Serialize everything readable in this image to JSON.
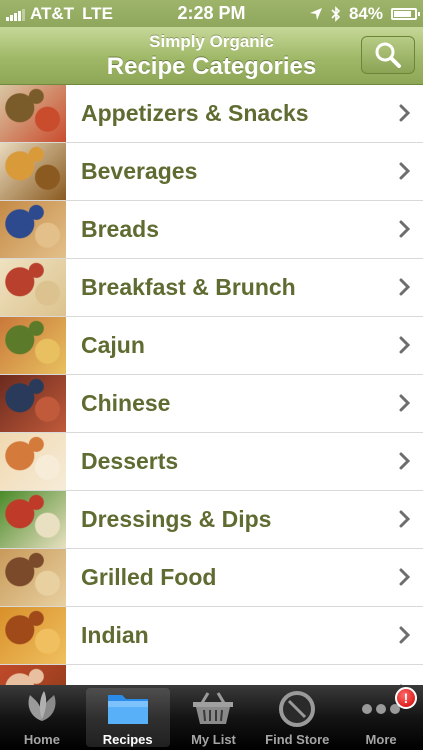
{
  "status_bar": {
    "carrier": "AT&T",
    "network": "LTE",
    "time": "2:28 PM",
    "battery": "84%",
    "battery_level": 0.84
  },
  "nav": {
    "subtitle": "Simply Organic",
    "title": "Recipe Categories",
    "search_icon": "magnifier-icon"
  },
  "categories": [
    {
      "label": "Appetizers & Snacks",
      "colors": [
        "#d9c7a4",
        "#7a5b2a",
        "#c94c2d"
      ]
    },
    {
      "label": "Beverages",
      "colors": [
        "#e8d9bd",
        "#d99a3a",
        "#8a5a20"
      ]
    },
    {
      "label": "Breads",
      "colors": [
        "#c58a46",
        "#2d4a8e",
        "#e3c08a"
      ]
    },
    {
      "label": "Breakfast & Brunch",
      "colors": [
        "#efe2c0",
        "#b8402c",
        "#dcc28f"
      ]
    },
    {
      "label": "Cajun",
      "colors": [
        "#c9783a",
        "#5b7a2a",
        "#e8c060"
      ]
    },
    {
      "label": "Chinese",
      "colors": [
        "#6b2a1e",
        "#2a3a5a",
        "#c05a3a"
      ]
    },
    {
      "label": "Desserts",
      "colors": [
        "#f0d8b0",
        "#d47a3a",
        "#f6ecd8"
      ]
    },
    {
      "label": "Dressings & Dips",
      "colors": [
        "#4a8a2a",
        "#c03a2a",
        "#e8e0c0"
      ]
    },
    {
      "label": "Grilled Food",
      "colors": [
        "#c89a5a",
        "#7a4a2a",
        "#e8d0a0"
      ]
    },
    {
      "label": "Indian",
      "colors": [
        "#d8902a",
        "#a04a1a",
        "#f0c060"
      ]
    },
    {
      "label": "",
      "colors": [
        "#c04a2a",
        "#e8c0a0",
        "#8a3a1a"
      ]
    }
  ],
  "tabs": [
    {
      "label": "Home",
      "icon": "leaf-icon"
    },
    {
      "label": "Recipes",
      "icon": "folder-icon"
    },
    {
      "label": "My List",
      "icon": "basket-icon"
    },
    {
      "label": "Find Store",
      "icon": "compass-icon"
    },
    {
      "label": "More",
      "icon": "more-dots-icon",
      "badge": "!"
    }
  ],
  "active_tab": "Recipes"
}
